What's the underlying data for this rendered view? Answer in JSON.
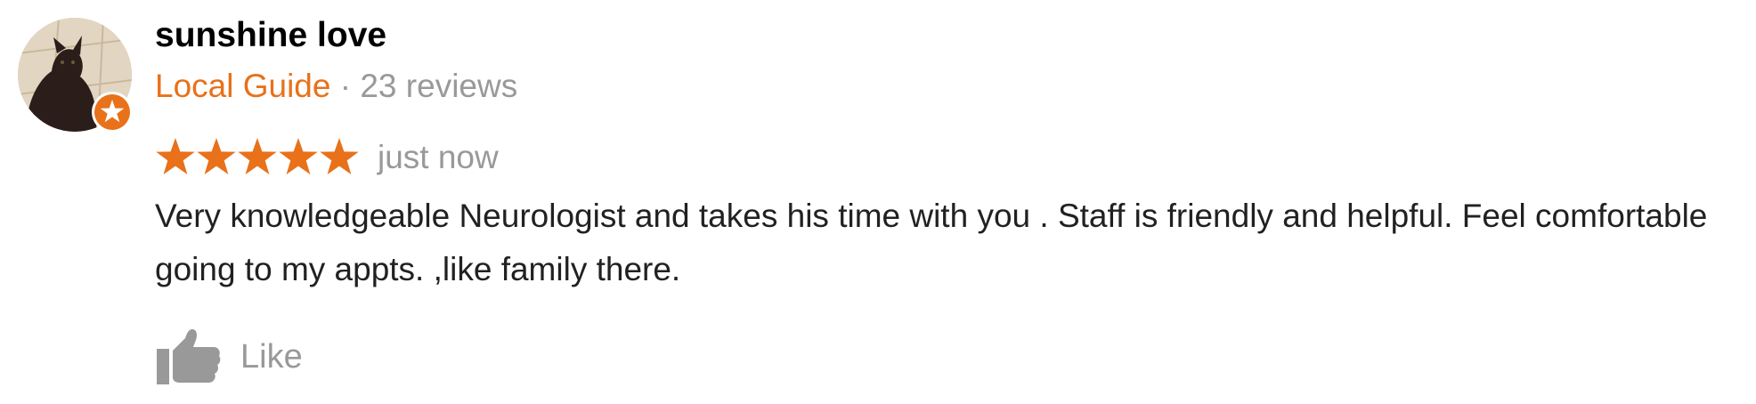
{
  "review": {
    "author_name": "sunshine love",
    "author_badge": "Local Guide",
    "separator": " · ",
    "review_count": "23 reviews",
    "rating": 5,
    "rating_max": 5,
    "time": "just now",
    "text": "Very knowledgeable Neurologist and takes his time with you . Staff is friendly and helpful. Feel comfortable going to my appts. ,like family there.",
    "like_label": "Like"
  },
  "icons": {
    "avatar": "user-photo-avatar",
    "badge": "local-guide-star-badge",
    "star": "star-icon",
    "like": "thumbs-up-icon"
  },
  "colors": {
    "accent": "#e8711a",
    "secondary_text": "#999999",
    "name_text": "#000000",
    "body_text": "#212121"
  }
}
